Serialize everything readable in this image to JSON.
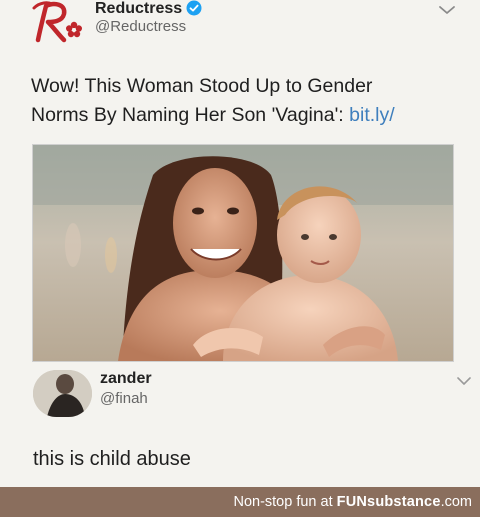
{
  "tweet": {
    "display_name": "Reductress",
    "handle": "@Reductress",
    "text_line1": "Wow! This Woman Stood Up to Gender",
    "text_line2": "Norms By Naming Her Son 'Vagina':",
    "link": "bit.ly/",
    "verified": true,
    "colors": {
      "link": "#3f7fbd",
      "verified": "#1da1f2",
      "logo": "#c0262b"
    },
    "icons": [
      "reductress-logo",
      "verified-badge-icon",
      "chevron-down-icon"
    ]
  },
  "reply": {
    "display_name": "zander",
    "handle": "@finah",
    "text": "this is child abuse",
    "icons": [
      "avatar",
      "chevron-down-icon"
    ]
  },
  "footer": {
    "prefix": "Non-stop fun at",
    "brand": "FUNsubstance",
    "suffix": ".com",
    "colors": {
      "background": "#8a6e5d",
      "text": "#ffffff"
    }
  }
}
